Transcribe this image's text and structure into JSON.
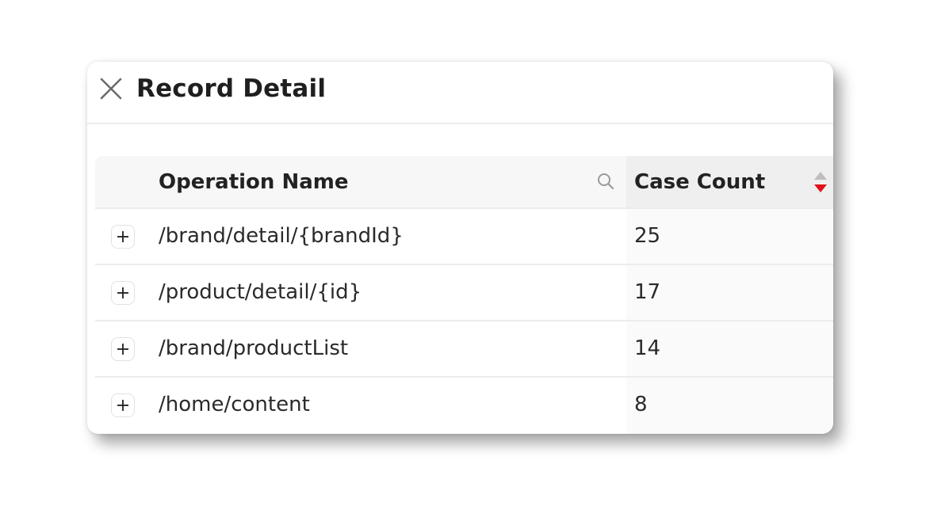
{
  "dialog": {
    "title": "Record Detail"
  },
  "table": {
    "columns": {
      "operation_name": "Operation Name",
      "case_count": "Case Count"
    },
    "sort": {
      "column": "case_count",
      "direction": "descending",
      "active_color": "#e0131a"
    },
    "rows": [
      {
        "operation_name": "/brand/detail/{brandId}",
        "case_count": "25"
      },
      {
        "operation_name": "/product/detail/{id}",
        "case_count": "17"
      },
      {
        "operation_name": "/brand/productList",
        "case_count": "14"
      },
      {
        "operation_name": "/home/content",
        "case_count": "8"
      }
    ]
  },
  "icons": {
    "close": "close-icon",
    "search": "search-icon",
    "expand": "plus-icon",
    "sort": "sort-caret-icon"
  }
}
